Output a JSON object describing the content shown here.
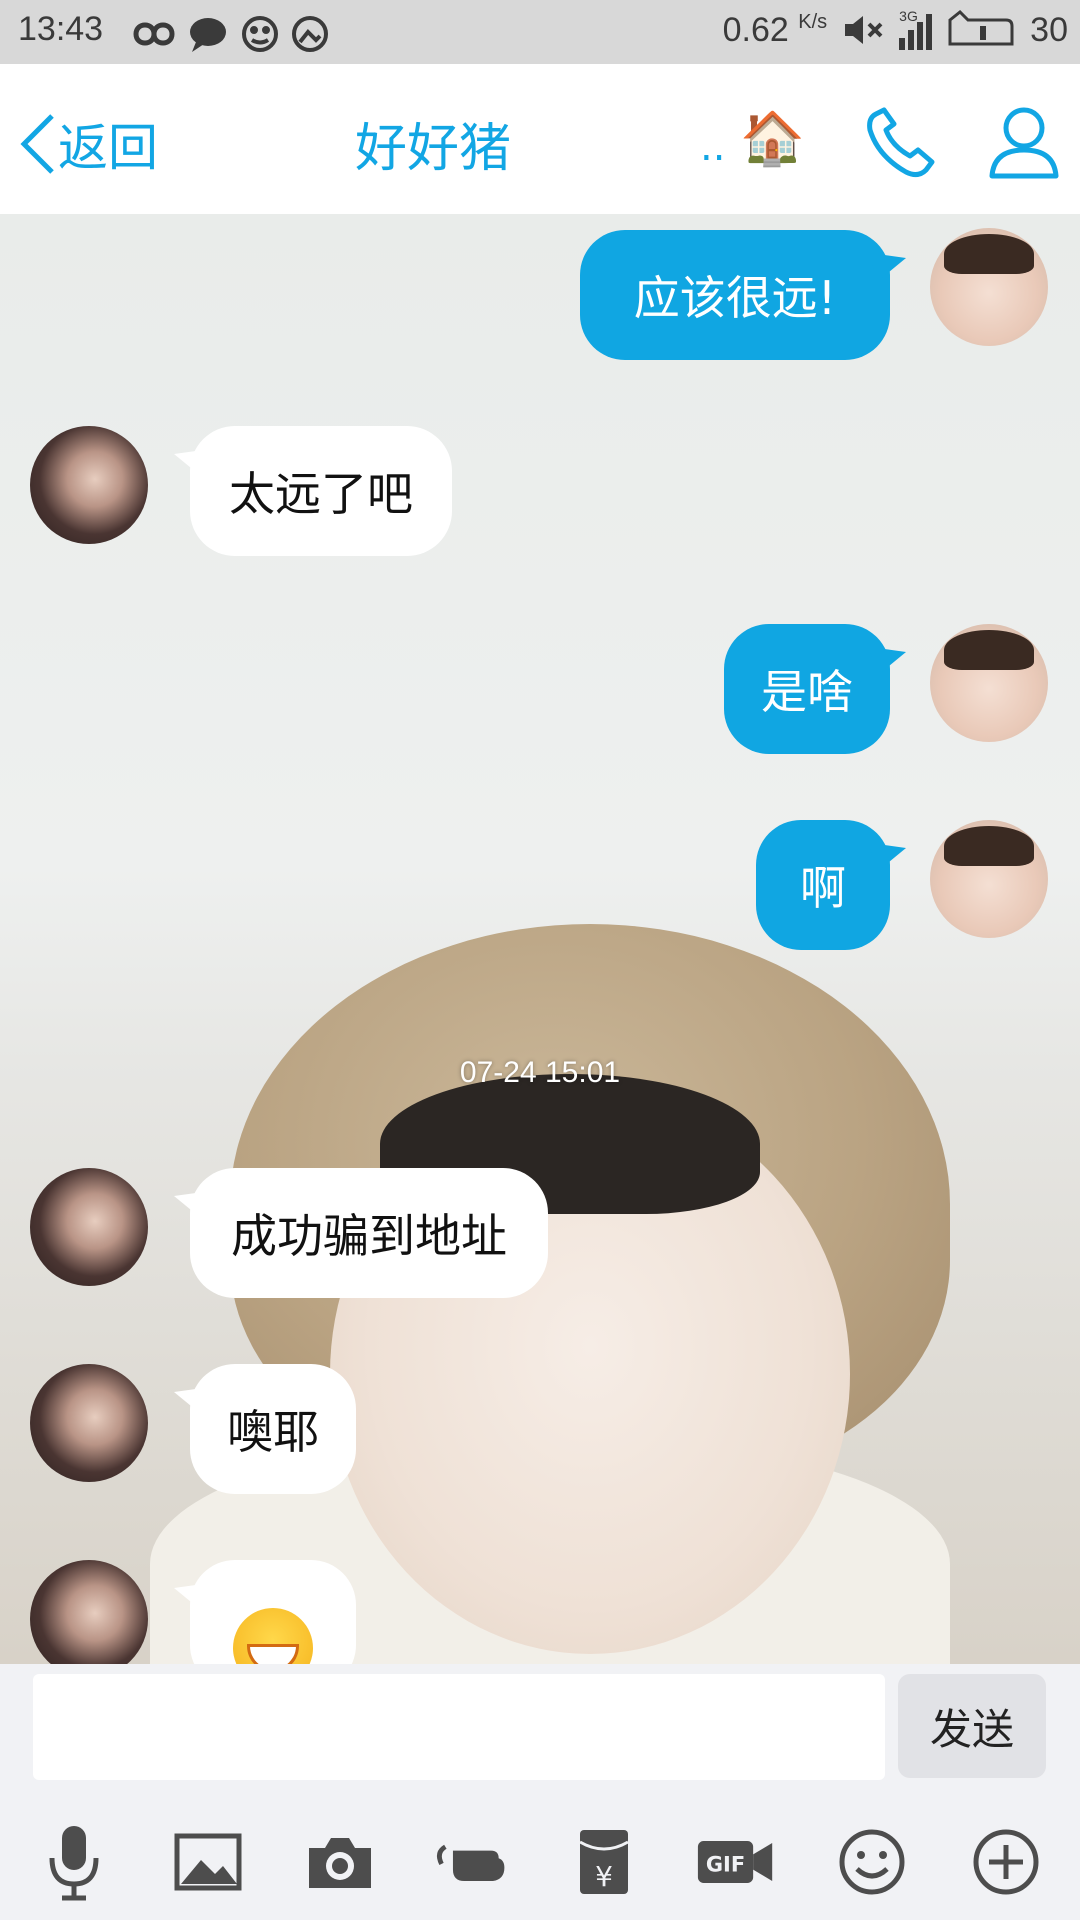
{
  "status_bar": {
    "time": "13:43",
    "speed": "0.62",
    "speed_unit": "K/s",
    "battery": "30",
    "network": "3G"
  },
  "nav": {
    "back_label": "返回",
    "title": "好好猪",
    "dots": "..",
    "house_icon": "🏠"
  },
  "messages": [
    {
      "side": "out",
      "text": "应该很远!"
    },
    {
      "side": "in",
      "text": "太远了吧"
    },
    {
      "side": "out",
      "text": "是啥"
    },
    {
      "side": "out",
      "text": "啊"
    },
    {
      "side": "in",
      "text": "成功骗到地址"
    },
    {
      "side": "in",
      "text": "噢耶"
    },
    {
      "side": "in",
      "text": "",
      "emoji": "grin-emoji"
    }
  ],
  "timestamp": "07-24 15:01",
  "input": {
    "value": "",
    "send_label": "发送"
  },
  "toolbar": {
    "icons": [
      "microphone-icon",
      "image-icon",
      "camera-icon",
      "poke-icon",
      "red-packet-icon",
      "gif-icon",
      "emoji-icon",
      "plus-icon"
    ],
    "red_packet_symbol": "¥",
    "gif_label": "GIF"
  },
  "colors": {
    "accent": "#12a6e4",
    "bubble_out": "#10a6e2",
    "bubble_in": "#ffffff"
  }
}
